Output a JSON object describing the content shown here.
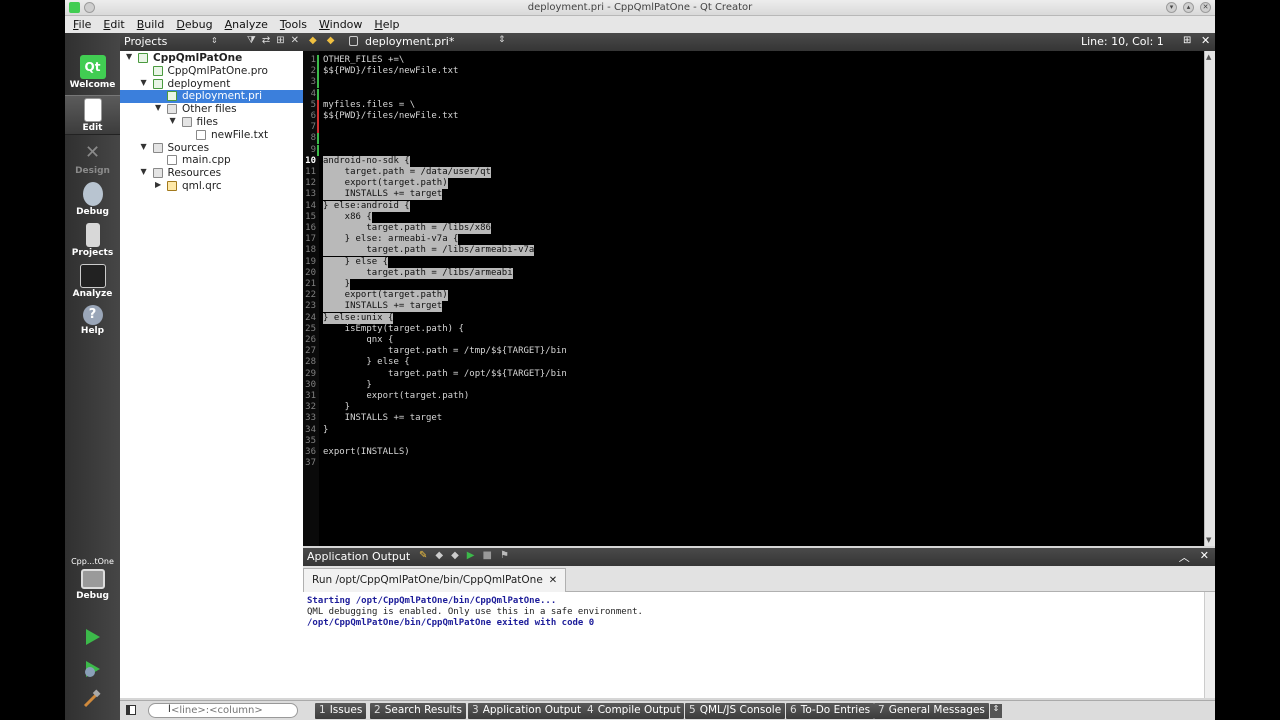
{
  "window": {
    "title": "deployment.pri - CppQmlPatOne - Qt Creator"
  },
  "menubar": [
    "File",
    "Edit",
    "Build",
    "Debug",
    "Analyze",
    "Tools",
    "Window",
    "Help"
  ],
  "modes": [
    "Welcome",
    "Edit",
    "Design",
    "Debug",
    "Projects",
    "Analyze",
    "Help"
  ],
  "kit": {
    "name": "Cpp...tOne",
    "mode": "Debug"
  },
  "projects": {
    "title": "Projects",
    "tree": [
      {
        "label": "CppQmlPatOne",
        "depth": 0,
        "expanded": true,
        "icon": "project-icon",
        "bold": true
      },
      {
        "label": "CppQmlPatOne.pro",
        "depth": 1,
        "icon": "pro-file-icon"
      },
      {
        "label": "deployment",
        "depth": 1,
        "expanded": true,
        "icon": "pri-folder-icon"
      },
      {
        "label": "deployment.pri",
        "depth": 2,
        "icon": "pri-file-icon",
        "selected": true
      },
      {
        "label": "Other files",
        "depth": 2,
        "expanded": true,
        "icon": "folder-icon"
      },
      {
        "label": "files",
        "depth": 3,
        "expanded": true,
        "icon": "folder-icon"
      },
      {
        "label": "newFile.txt",
        "depth": 4,
        "icon": "file-icon"
      },
      {
        "label": "Sources",
        "depth": 1,
        "expanded": true,
        "icon": "folder-icon"
      },
      {
        "label": "main.cpp",
        "depth": 2,
        "icon": "cpp-file-icon"
      },
      {
        "label": "Resources",
        "depth": 1,
        "expanded": true,
        "icon": "folder-icon"
      },
      {
        "label": "qml.qrc",
        "depth": 2,
        "collapsed": true,
        "icon": "qrc-file-icon"
      }
    ]
  },
  "editor": {
    "file": "deployment.pri*",
    "position": "Line: 10, Col: 1",
    "lines": [
      {
        "n": "1",
        "text": "OTHER_FILES +=\\",
        "hl": "var"
      },
      {
        "n": "2",
        "text": "$${PWD}/files/newFile.txt"
      },
      {
        "n": "3",
        "text": ""
      },
      {
        "n": "4",
        "text": ""
      },
      {
        "n": "5",
        "text": "myfiles.files = \\"
      },
      {
        "n": "6",
        "text": "$${PWD}/files/newFile.txt"
      },
      {
        "n": "7",
        "text": ""
      },
      {
        "n": "8",
        "text": ""
      },
      {
        "n": "9",
        "text": ""
      },
      {
        "n": "10",
        "text": "android-no-sdk {",
        "sel": true,
        "cur": true
      },
      {
        "n": "11",
        "text": "    target.path = /data/user/qt",
        "sel": true
      },
      {
        "n": "12",
        "text": "    export(target.path)",
        "sel": true
      },
      {
        "n": "13",
        "text": "    INSTALLS += target",
        "sel": true
      },
      {
        "n": "14",
        "text": "} else:android {",
        "sel": true
      },
      {
        "n": "15",
        "text": "    x86 {",
        "sel": true
      },
      {
        "n": "16",
        "text": "        target.path = /libs/x86",
        "sel": true
      },
      {
        "n": "17",
        "text": "    } else: armeabi-v7a {",
        "sel": true
      },
      {
        "n": "18",
        "text": "        target.path = /libs/armeabi-v7a",
        "sel": true
      },
      {
        "n": "19",
        "text": "    } else {",
        "sel": true
      },
      {
        "n": "20",
        "text": "        target.path = /libs/armeabi",
        "sel": true
      },
      {
        "n": "21",
        "text": "    }",
        "sel": true
      },
      {
        "n": "22",
        "text": "    export(target.path)",
        "sel": true
      },
      {
        "n": "23",
        "text": "    INSTALLS += target",
        "sel": true
      },
      {
        "n": "24",
        "text": "} else:unix {",
        "sel": true
      },
      {
        "n": "25",
        "text": "    isEmpty(target.path) {"
      },
      {
        "n": "26",
        "text": "        qnx {"
      },
      {
        "n": "27",
        "text": "            target.path = /tmp/$${TARGET}/bin"
      },
      {
        "n": "28",
        "text": "        } else {"
      },
      {
        "n": "29",
        "text": "            target.path = /opt/$${TARGET}/bin"
      },
      {
        "n": "30",
        "text": "        }"
      },
      {
        "n": "31",
        "text": "        export(target.path)"
      },
      {
        "n": "32",
        "text": "    }"
      },
      {
        "n": "33",
        "text": "    INSTALLS += target"
      },
      {
        "n": "34",
        "text": "}"
      },
      {
        "n": "35",
        "text": ""
      },
      {
        "n": "36",
        "text": "export(INSTALLS)"
      },
      {
        "n": "37",
        "text": ""
      }
    ]
  },
  "output": {
    "title": "Application Output",
    "tab": "Run /opt/CppQmlPatOne/bin/CppQmlPatOne",
    "lines": [
      {
        "text": "Starting /opt/CppQmlPatOne/bin/CppQmlPatOne...",
        "bold": true
      },
      {
        "text": "QML debugging is enabled. Only use this in a safe environment.",
        "bold": false
      },
      {
        "text": "/opt/CppQmlPatOne/bin/CppQmlPatOne exited with code 0",
        "bold": true
      }
    ]
  },
  "locator": {
    "placeholder": "<line>:<column>",
    "prefix": "l"
  },
  "statusbar": [
    {
      "num": "1",
      "label": "Issues"
    },
    {
      "num": "2",
      "label": "Search Results"
    },
    {
      "num": "3",
      "label": "Application Output"
    },
    {
      "num": "4",
      "label": "Compile Output"
    },
    {
      "num": "5",
      "label": "QML/JS Console"
    },
    {
      "num": "6",
      "label": "To-Do Entries"
    },
    {
      "num": "7",
      "label": "General Messages"
    }
  ],
  "colors": {
    "accent": "#3b7fdc",
    "run": "#3cb94a",
    "qt_green": "#41cd52"
  }
}
